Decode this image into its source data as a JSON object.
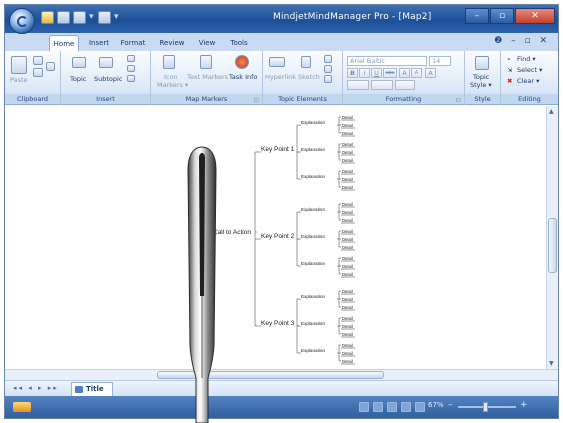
{
  "window": {
    "title": "MindjetMindManager Pro - [Map2]",
    "controls": {
      "minimize": "–",
      "maximize": "▫",
      "close": "✕"
    }
  },
  "tabs": [
    {
      "label": "Home",
      "active": true
    },
    {
      "label": "Insert",
      "active": false
    },
    {
      "label": "Format",
      "active": false
    },
    {
      "label": "Review",
      "active": false
    },
    {
      "label": "View",
      "active": false
    },
    {
      "label": "Tools",
      "active": false
    }
  ],
  "help": "❷ – ▫ ✕",
  "ribbon": {
    "clipboard": {
      "label": "Clipboard",
      "paste": "Paste"
    },
    "insert": {
      "label": "Insert",
      "topic": "Topic",
      "subtopic": "Subtopic"
    },
    "markers": {
      "label": "Map Markers",
      "icon_markers_1": "Icon",
      "icon_markers_2": "Markers ▾",
      "text_markers": "Text Markers",
      "task_info": "Task Info",
      "launcher": "⊡"
    },
    "topic_elements": {
      "label": "Topic Elements",
      "hyperlink": "Hyperlink",
      "sketch": "Sketch"
    },
    "formatting": {
      "label": "Formatting",
      "font": "Arial Baltic",
      "size": "14",
      "bold": "B",
      "italic": "I",
      "underline": "U",
      "strike": "abc",
      "grow": "A",
      "shrink": "A",
      "color": "A",
      "launcher": "⊡"
    },
    "style": {
      "label": "Style",
      "topic_style_1": "Topic",
      "topic_style_2": "Style ▾",
      "launcher": "⊡"
    },
    "editing": {
      "label": "Editing",
      "find": "Find ▾",
      "select": "Select ▾",
      "clear": "Clear ▾"
    }
  },
  "map": {
    "central": "Call to Action",
    "branches": [
      {
        "label": "Key Point 1",
        "explanations": [
          {
            "label": "Explanation",
            "details": [
              "Detail",
              "Detail",
              "Detail"
            ]
          },
          {
            "label": "Explanation",
            "details": [
              "Detail",
              "Detail",
              "Detail"
            ]
          },
          {
            "label": "Explanation",
            "details": [
              "Detail",
              "Detail",
              "Detail"
            ]
          }
        ]
      },
      {
        "label": "Key Point 2",
        "explanations": [
          {
            "label": "Explanation",
            "details": [
              "Detail",
              "Detail",
              "Detail"
            ]
          },
          {
            "label": "Explanation",
            "details": [
              "Detail",
              "Detail",
              "Detail"
            ]
          },
          {
            "label": "Explanation",
            "details": [
              "Detail",
              "Detail",
              "Detail"
            ]
          }
        ]
      },
      {
        "label": "Key Point 3",
        "explanations": [
          {
            "label": "Explanation",
            "details": [
              "Detail",
              "Detail",
              "Detail"
            ]
          },
          {
            "label": "Explanation",
            "details": [
              "Detail",
              "Detail",
              "Detail"
            ]
          },
          {
            "label": "Explanation",
            "details": [
              "Detail",
              "Detail",
              "Detail"
            ]
          }
        ]
      }
    ]
  },
  "sheet": {
    "tab": "Title",
    "nav": "◂◂ ◂ ▸ ▸▸"
  },
  "status": {
    "zoom": "67%",
    "minus": "–",
    "plus": "+"
  },
  "colors": {
    "titlebar": "#2a5ca6",
    "ribbon": "#dde9f7",
    "status": "#3b6aab",
    "task_info_icon": "#d04020"
  },
  "icons": [
    "orb-icon",
    "save-icon",
    "undo-icon",
    "redo-icon",
    "paste-icon",
    "topic-icon",
    "subtopic-icon",
    "icon-markers-icon",
    "text-markers-icon",
    "task-info-icon",
    "hyperlink-icon",
    "sketch-icon",
    "topic-style-icon",
    "find-icon",
    "select-icon",
    "clear-icon",
    "needle-tool-icon"
  ]
}
